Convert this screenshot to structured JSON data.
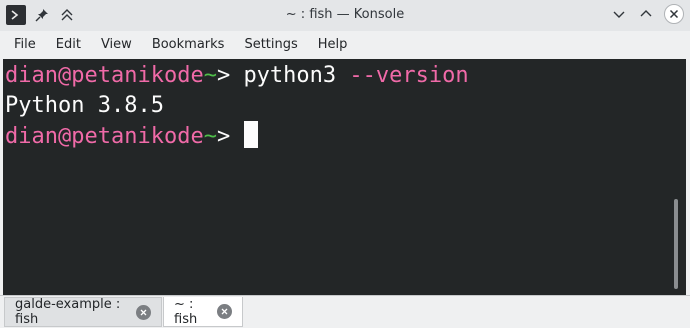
{
  "window": {
    "title": "~ : fish — Konsole"
  },
  "menu": {
    "items": [
      "File",
      "Edit",
      "View",
      "Bookmarks",
      "Settings",
      "Help"
    ]
  },
  "terminal": {
    "line1": {
      "user": "dian",
      "at": "@",
      "host": "petanikode",
      "cwd": "~",
      "prompt": "> ",
      "command": "python3",
      "flag": " --version"
    },
    "line2": {
      "output": "Python 3.8.5"
    },
    "line3": {
      "user": "dian",
      "at": "@",
      "host": "petanikode",
      "cwd": "~",
      "prompt": "> "
    }
  },
  "tabs": [
    {
      "label": "galde-example : fish",
      "active": false
    },
    {
      "label": "~ : fish",
      "active": true
    }
  ],
  "colors": {
    "terminal_bg": "#232627",
    "prompt_user": "#f06aa8",
    "prompt_cwd": "#4fbf4a",
    "text": "#fcfcfc"
  },
  "icons": {
    "app": "terminal-icon",
    "pin": "pin-icon",
    "keep_above": "keep-above-icon",
    "minimize": "chevron-down-icon",
    "maximize": "chevron-up-icon",
    "close": "close-icon"
  }
}
